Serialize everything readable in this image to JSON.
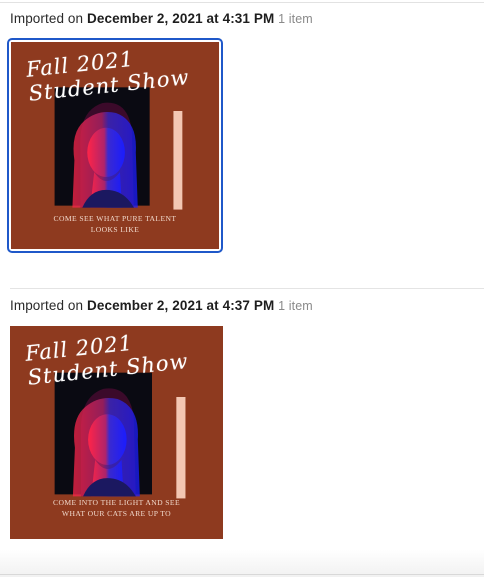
{
  "groups": [
    {
      "prefix": "Imported on ",
      "date": "December 2, 2021 at 4:31 PM",
      "count": "1 item",
      "thumbnail": {
        "selected": true,
        "title_line1": "Fall 2021",
        "title_line2": "Student Show",
        "tagline_line1": "COME SEE WHAT  PURE TALENT",
        "tagline_line2": "LOOKS LIKE"
      }
    },
    {
      "prefix": "Imported on ",
      "date": "December 2, 2021 at 4:37 PM",
      "count": "1 item",
      "thumbnail": {
        "selected": false,
        "title_line1": "Fall 2021",
        "title_line2": "Student Show",
        "tagline_line1": "COME INTO THE LIGHT AND SEE",
        "tagline_line2": "WHAT OUR CATS ARE UP TO"
      }
    }
  ],
  "colors": {
    "selection": "#1f58c9",
    "poster_background": "#8e3a1f",
    "accent_stripe": "#f3c7b3"
  }
}
